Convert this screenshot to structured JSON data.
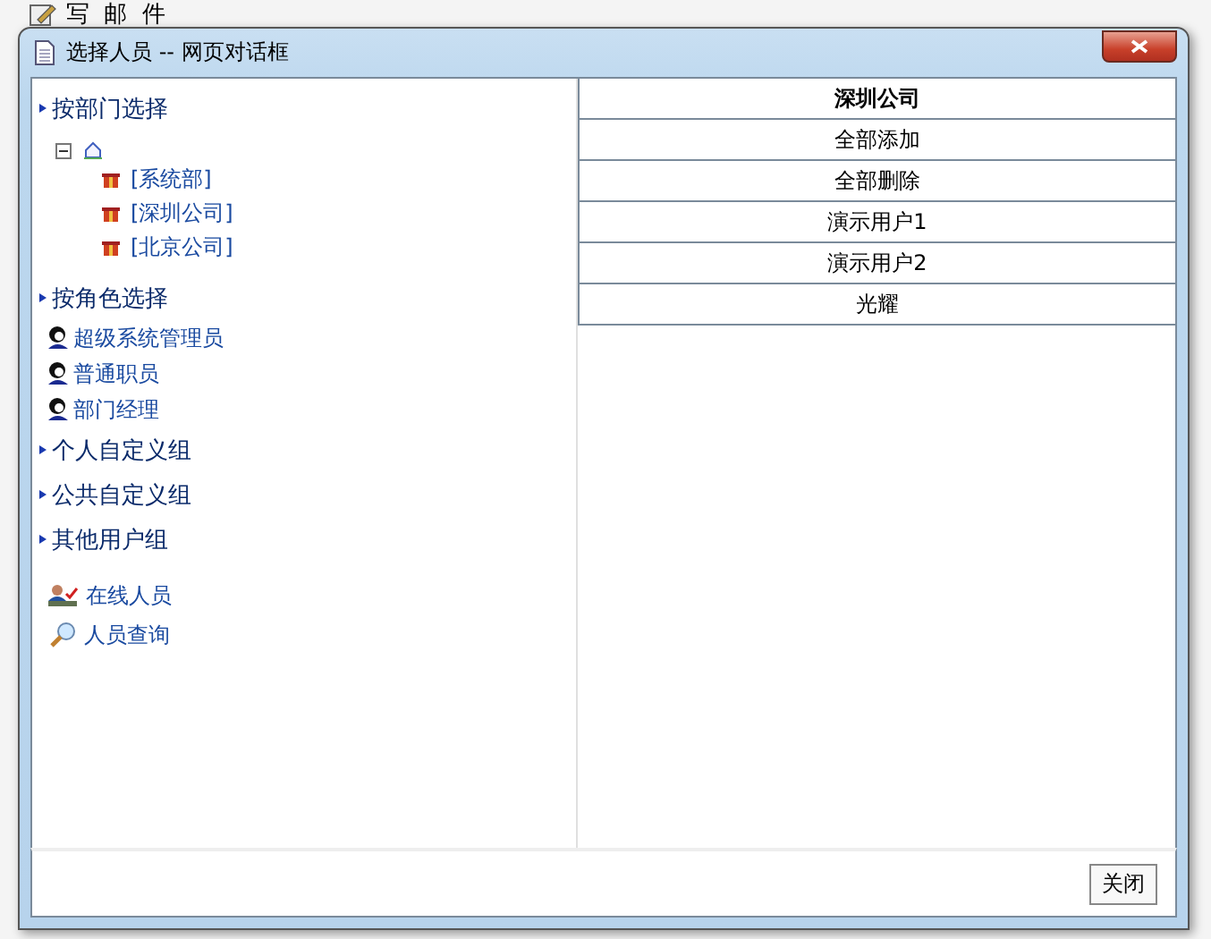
{
  "background_page": {
    "title": "写 邮 件"
  },
  "dialog": {
    "title": "选择人员 -- 网页对话框"
  },
  "sidebar": {
    "items": [
      {
        "kind": "section",
        "label": "按部门选择"
      },
      {
        "kind": "tree",
        "expanded": true,
        "children": [
          {
            "label": "[系统部]"
          },
          {
            "label": "[深圳公司]"
          },
          {
            "label": "[北京公司]"
          }
        ]
      },
      {
        "kind": "section",
        "label": "按角色选择"
      },
      {
        "kind": "role",
        "label": "超级系统管理员"
      },
      {
        "kind": "role",
        "label": "普通职员"
      },
      {
        "kind": "role",
        "label": "部门经理"
      },
      {
        "kind": "section",
        "label": "个人自定义组"
      },
      {
        "kind": "section",
        "label": "公共自定义组"
      },
      {
        "kind": "section",
        "label": "其他用户组"
      },
      {
        "kind": "online",
        "label": "在线人员"
      },
      {
        "kind": "search",
        "label": "人员查询"
      }
    ]
  },
  "table": {
    "header": "深圳公司",
    "rows": [
      "全部添加",
      "全部删除",
      "演示用户1",
      "演示用户2",
      "光耀"
    ]
  },
  "footer": {
    "button": "关闭"
  }
}
